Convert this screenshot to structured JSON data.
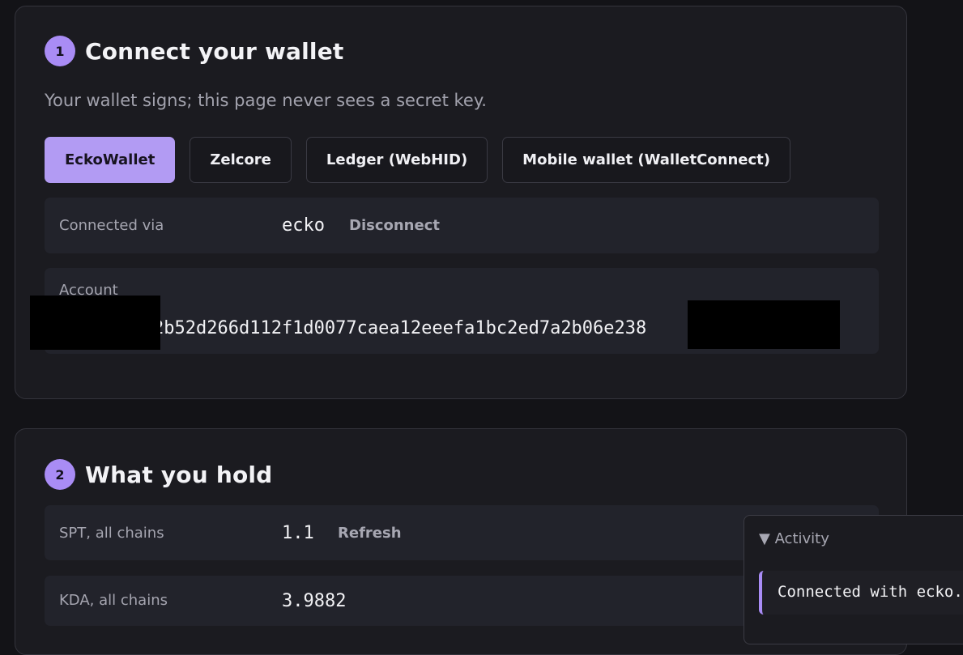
{
  "step1": {
    "number": "1",
    "title": "Connect your wallet",
    "subtitle": "Your wallet signs; this page never sees a secret key.",
    "wallets": [
      {
        "label": "EckoWallet",
        "active": true
      },
      {
        "label": "Zelcore",
        "active": false
      },
      {
        "label": "Ledger (WebHID)",
        "active": false
      },
      {
        "label": "Mobile wallet (WalletConnect)",
        "active": false
      }
    ],
    "connected": {
      "label": "Connected via",
      "value": "ecko",
      "disconnect_label": "Disconnect"
    },
    "account": {
      "label": "Account",
      "value": "2b52d266d112f1d0077caea12eeefa1bc2ed7a2b06e238"
    }
  },
  "step2": {
    "number": "2",
    "title": "What you hold",
    "spt": {
      "label": "SPT, all chains",
      "value": "1.1",
      "refresh_label": "Refresh"
    },
    "kda": {
      "label": "KDA, all chains",
      "value": "3.9882"
    }
  },
  "activity": {
    "summary": "▼ Activity",
    "entries": [
      "Connected with ecko."
    ]
  },
  "colors": {
    "accent": "#a98cf5",
    "active_button": "#b29bf3",
    "background": "#131317",
    "card": "#1b1b20"
  }
}
